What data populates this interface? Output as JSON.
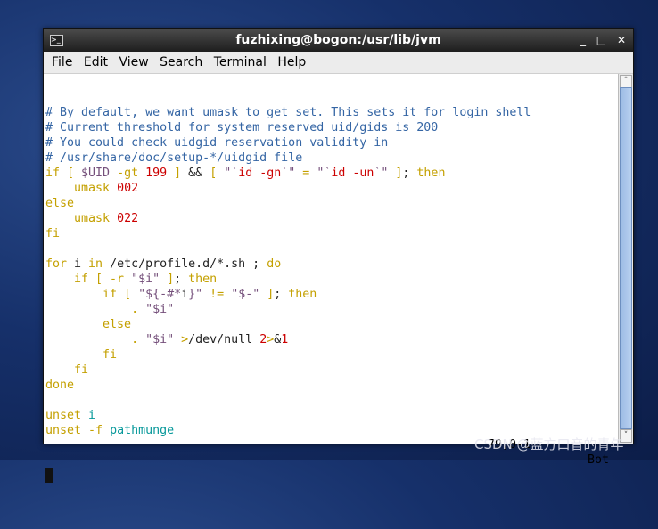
{
  "window": {
    "title": "fuzhixing@bogon:/usr/lib/jvm"
  },
  "menu": [
    "File",
    "Edit",
    "View",
    "Search",
    "Terminal",
    "Help"
  ],
  "colors": {
    "comment": "#3465a4",
    "keyword": "#c4a000",
    "number": "#cc0000",
    "variable": "#75507b",
    "command": "#06989a"
  },
  "lines": [
    [
      [
        "# By default, we want umask to get set. This sets it for login shell",
        "c"
      ]
    ],
    [
      [
        "# Current threshold for system reserved uid/gids is 200",
        "c"
      ]
    ],
    [
      [
        "# You could check uidgid reservation validity in",
        "c"
      ]
    ],
    [
      [
        "# /usr/share/doc/setup-*/uidgid file",
        "c"
      ]
    ],
    [
      [
        "if [ ",
        "k"
      ],
      [
        "$UID",
        "p"
      ],
      [
        " -gt ",
        "k"
      ],
      [
        "199",
        "r"
      ],
      [
        " ] ",
        "k"
      ],
      [
        "&& ",
        "n"
      ],
      [
        "[ ",
        "k"
      ],
      [
        "\"`",
        "p"
      ],
      [
        "id -gn",
        "r"
      ],
      [
        "`\"",
        "p"
      ],
      [
        " = ",
        "k"
      ],
      [
        "\"`",
        "p"
      ],
      [
        "id -un",
        "r"
      ],
      [
        "`\"",
        "p"
      ],
      [
        " ]",
        "k"
      ],
      [
        "; ",
        "n"
      ],
      [
        "then",
        "k"
      ]
    ],
    [
      [
        "    umask ",
        "k"
      ],
      [
        "002",
        "r"
      ]
    ],
    [
      [
        "else",
        "k"
      ]
    ],
    [
      [
        "    umask ",
        "k"
      ],
      [
        "022",
        "r"
      ]
    ],
    [
      [
        "fi",
        "k"
      ]
    ],
    [
      [
        "",
        ""
      ]
    ],
    [
      [
        "for ",
        "k"
      ],
      [
        "i ",
        "n"
      ],
      [
        "in ",
        "k"
      ],
      [
        "/etc/profile.d/*.sh ; ",
        "n"
      ],
      [
        "do",
        "k"
      ]
    ],
    [
      [
        "    if [ -r ",
        "k"
      ],
      [
        "\"$i\"",
        "p"
      ],
      [
        " ]",
        "k"
      ],
      [
        "; ",
        "n"
      ],
      [
        "then",
        "k"
      ]
    ],
    [
      [
        "        if [ ",
        "k"
      ],
      [
        "\"${-#*",
        "p"
      ],
      [
        "i",
        "n"
      ],
      [
        "}\"",
        "p"
      ],
      [
        " != ",
        "k"
      ],
      [
        "\"$-\"",
        "p"
      ],
      [
        " ]",
        "k"
      ],
      [
        "; ",
        "n"
      ],
      [
        "then",
        "k"
      ]
    ],
    [
      [
        "            . ",
        "k"
      ],
      [
        "\"$i\"",
        "p"
      ]
    ],
    [
      [
        "        else",
        "k"
      ]
    ],
    [
      [
        "            . ",
        "k"
      ],
      [
        "\"$i\" ",
        "p"
      ],
      [
        ">",
        "k"
      ],
      [
        "/dev/null ",
        "n"
      ],
      [
        "2",
        "r"
      ],
      [
        ">",
        "k"
      ],
      [
        "&",
        "n"
      ],
      [
        "1",
        "r"
      ]
    ],
    [
      [
        "        fi",
        "k"
      ]
    ],
    [
      [
        "    fi",
        "k"
      ]
    ],
    [
      [
        "done",
        "k"
      ]
    ],
    [
      [
        "",
        ""
      ]
    ],
    [
      [
        "unset ",
        "k"
      ],
      [
        "i",
        "t"
      ]
    ],
    [
      [
        "unset -f ",
        "k"
      ],
      [
        "pathmunge",
        "t"
      ]
    ]
  ],
  "status": {
    "position": "79,0-1",
    "scroll": "Bot"
  },
  "watermark": "CSDN @蓝方口音的青年"
}
